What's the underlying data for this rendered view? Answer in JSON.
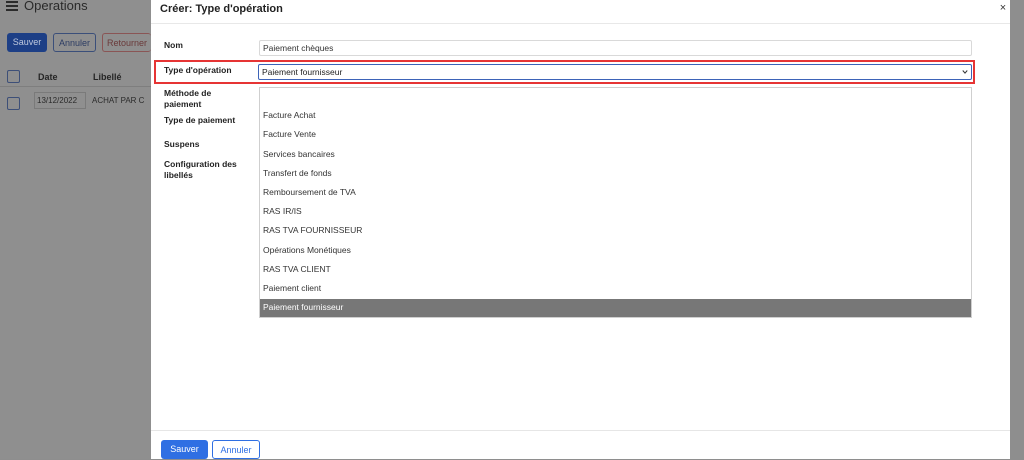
{
  "background": {
    "title": "Operations",
    "buttons": {
      "save": "Sauver",
      "cancel": "Annuler",
      "return": "Retourner"
    },
    "table": {
      "headers": {
        "date": "Date",
        "label": "Libellé"
      },
      "rows": [
        {
          "date": "13/12/2022",
          "label": "ACHAT PAR C"
        }
      ]
    }
  },
  "modal": {
    "title": "Créer: Type d'opération",
    "close": "×",
    "fields": {
      "name_label": "Nom",
      "name_value": "Paiement chèques",
      "op_type_label": "Type d'opération",
      "op_type_value": "Paiement fournisseur",
      "payment_method_label": "Méthode de paiement",
      "payment_type_label": "Type de paiement",
      "suspense_label": "Suspens",
      "label_config_label": "Configuration des libellés"
    },
    "dropdown": {
      "options": [
        "",
        "Facture Achat",
        "Facture Vente",
        "Services bancaires",
        "Transfert de fonds",
        "Remboursement de TVA",
        "RAS IR/IS",
        "RAS TVA FOURNISSEUR",
        "Opérations Monétiques",
        "RAS TVA CLIENT",
        "Paiement client",
        "Paiement fournisseur"
      ],
      "selected": "Paiement fournisseur"
    },
    "footer": {
      "save": "Sauver",
      "cancel": "Annuler"
    }
  },
  "colors": {
    "primary": "#2f6fe3",
    "highlight": "#e63434",
    "selected_option": "#777777",
    "overlay": "#8e8e8e"
  },
  "icons": {
    "menu": "hamburger-icon",
    "close": "close-icon",
    "select_arrow": "chevron-down-icon",
    "annotation": "arrow-icon"
  }
}
